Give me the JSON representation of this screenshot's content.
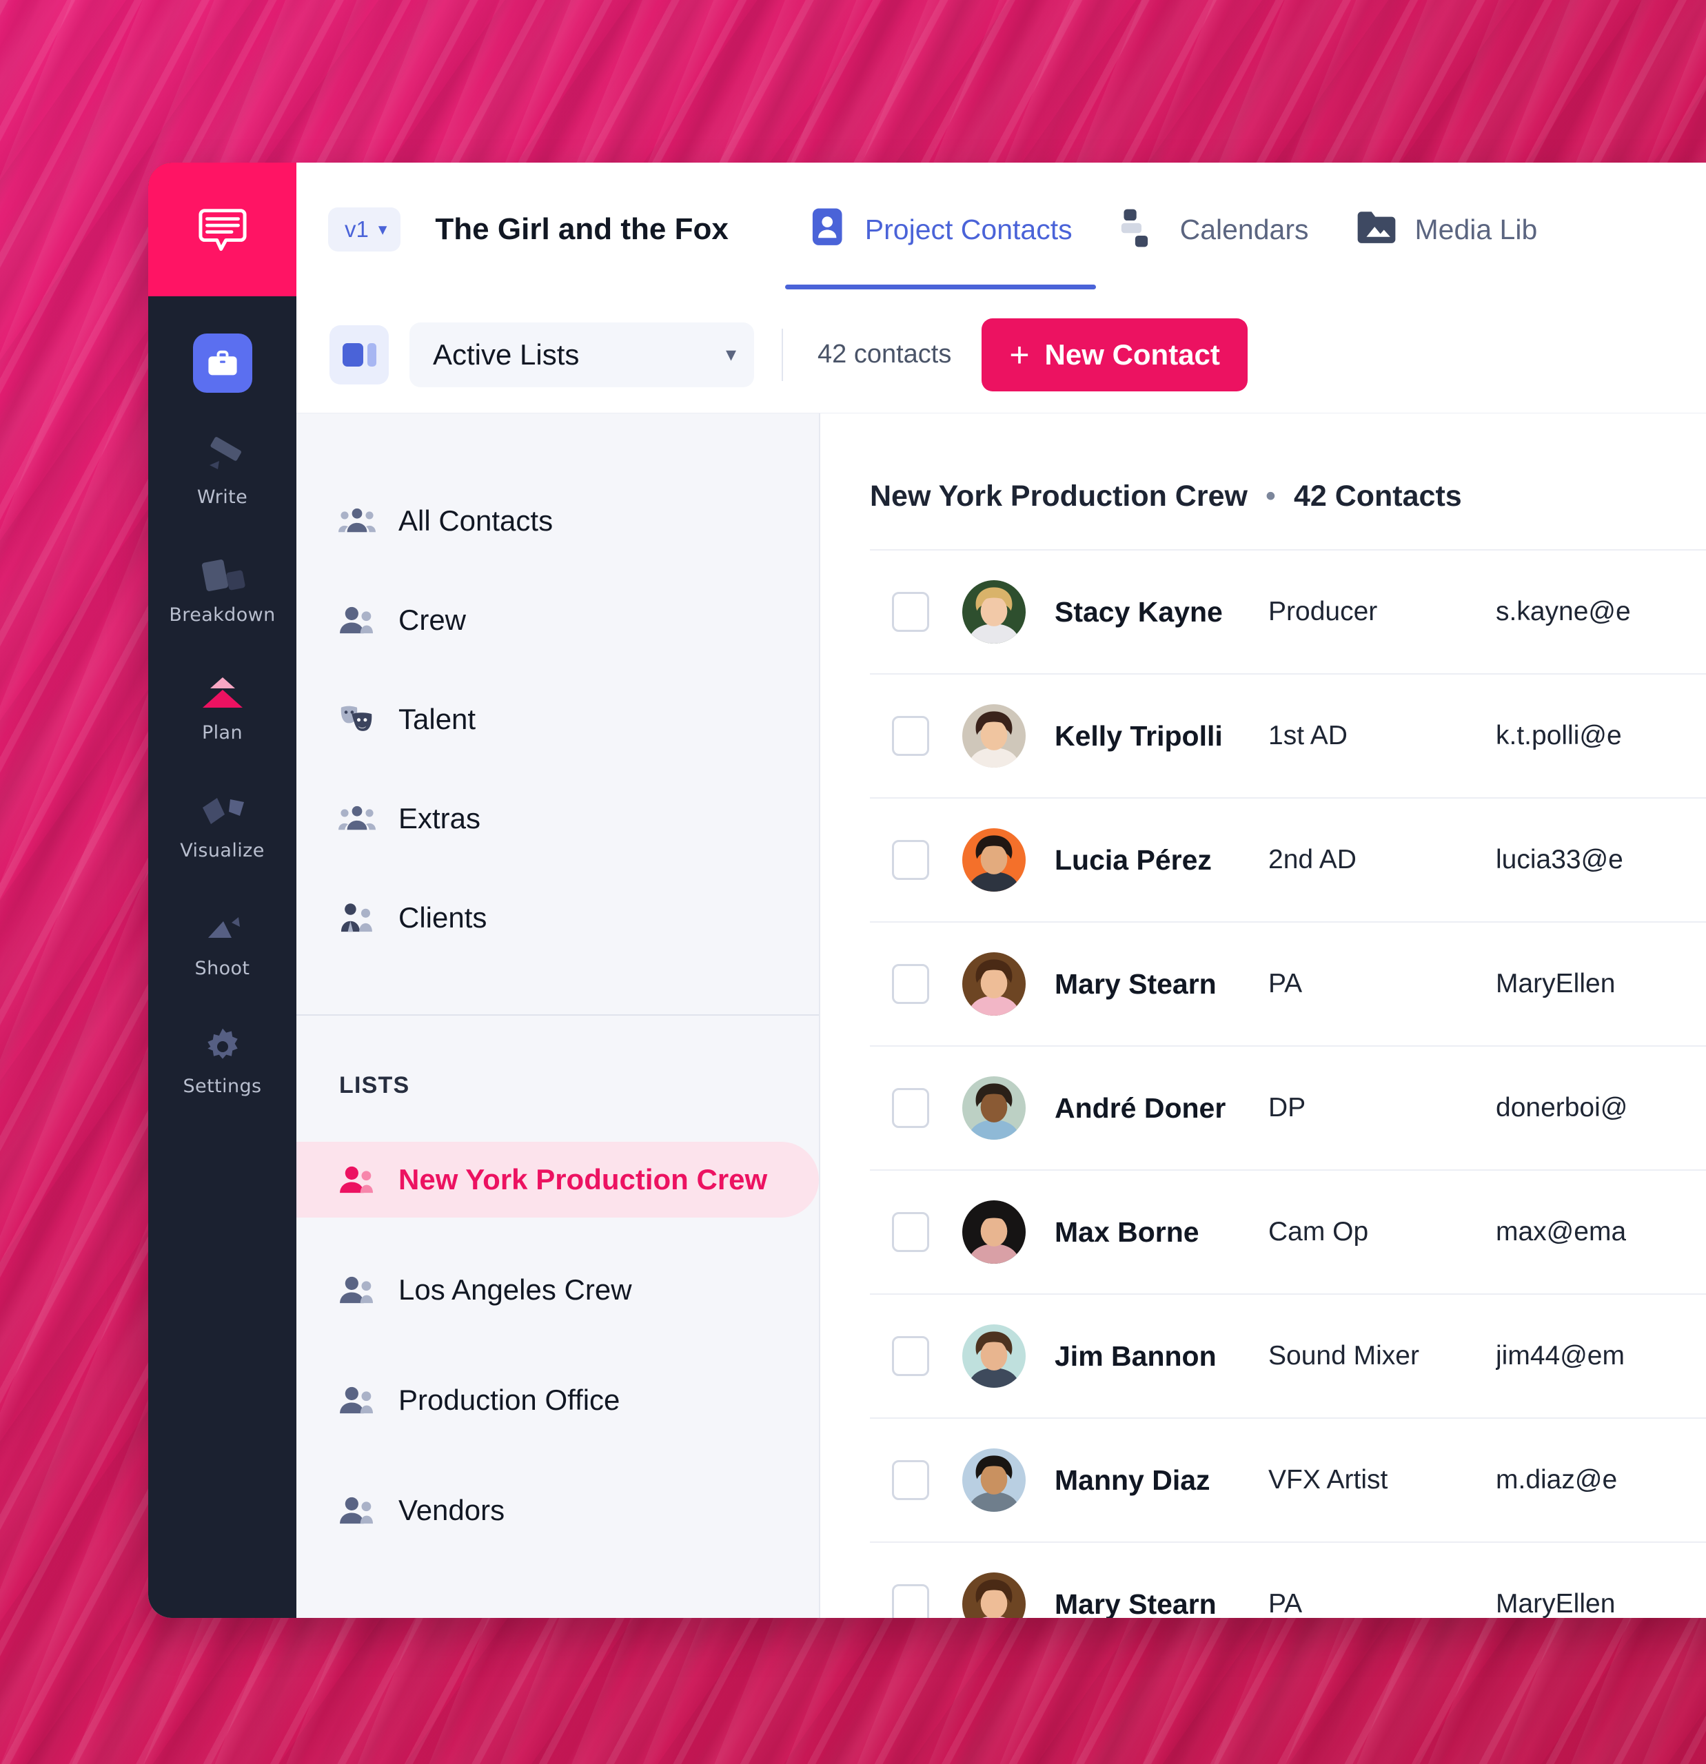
{
  "colors": {
    "brand_pink": "#ec1261",
    "logo_pink": "#ff1464",
    "accent_blue": "#4a63d8",
    "rail_dark": "#1b2130",
    "panel_bg": "#f5f6fa",
    "active_list_bg": "#fce3ec",
    "backdrop_pink": "#d81b60"
  },
  "rail": {
    "logo_icon": "speech-bubble-logo",
    "projects_button": {
      "icon": "briefcase-icon"
    },
    "items": [
      {
        "label": "Write",
        "icon": "pen-icon"
      },
      {
        "label": "Breakdown",
        "icon": "cards-icon"
      },
      {
        "label": "Plan",
        "icon": "triangles-icon",
        "active": true
      },
      {
        "label": "Visualize",
        "icon": "shapes-icon"
      },
      {
        "label": "Shoot",
        "icon": "arrow-shapes-icon"
      },
      {
        "label": "Settings",
        "icon": "gear-icon"
      }
    ]
  },
  "header": {
    "version_chip": {
      "label": "v1",
      "caret": "chevron-down-icon"
    },
    "project_title": "The Girl and the Fox",
    "tabs": [
      {
        "label": "Project Contacts",
        "icon": "contact-card-icon",
        "active": true
      },
      {
        "label": "Calendars",
        "icon": "calendar-blocks-icon",
        "active": false
      },
      {
        "label": "Media Lib",
        "icon": "media-folder-icon",
        "active": false
      }
    ]
  },
  "toolbar": {
    "view_toggle_icon": "split-view-icon",
    "list_select": {
      "value": "Active Lists",
      "caret": "chevron-down-icon"
    },
    "contacts_count": "42 contacts",
    "new_contact": {
      "label": "New Contact",
      "icon": "plus-icon"
    }
  },
  "lists_panel": {
    "categories": [
      {
        "label": "All Contacts",
        "icon": "group-icon"
      },
      {
        "label": "Crew",
        "icon": "two-people-icon"
      },
      {
        "label": "Talent",
        "icon": "theater-masks-icon"
      },
      {
        "label": "Extras",
        "icon": "group-icon"
      },
      {
        "label": "Clients",
        "icon": "business-people-icon"
      }
    ],
    "lists_heading": "LISTS",
    "lists": [
      {
        "label": "New York Production Crew",
        "icon": "two-people-icon",
        "active": true
      },
      {
        "label": "Los Angeles Crew",
        "icon": "two-people-icon",
        "active": false
      },
      {
        "label": "Production Office",
        "icon": "two-people-icon",
        "active": false
      },
      {
        "label": "Vendors",
        "icon": "two-people-icon",
        "active": false
      }
    ]
  },
  "contacts_panel": {
    "heading_title": "New York Production Crew",
    "heading_separator": "•",
    "heading_count": "42 Contacts",
    "rows": [
      {
        "name": "Stacy Kayne",
        "role": "Producer",
        "email": "s.kayne@e",
        "skin": "#f2c9a8",
        "hair": "#d9b36a",
        "bg": "#2e4f2e",
        "shirt": "#e8e8ec"
      },
      {
        "name": "Kelly Tripolli",
        "role": "1st AD",
        "email": "k.t.polli@e",
        "skin": "#f0c5a0",
        "hair": "#3a231b",
        "bg": "#cfc7ba",
        "shirt": "#f3ece6"
      },
      {
        "name": "Lucia Pérez",
        "role": "2nd AD",
        "email": "lucia33@e",
        "skin": "#e3ab7e",
        "hair": "#211713",
        "bg": "#f4702a",
        "shirt": "#2d3440"
      },
      {
        "name": "Mary Stearn",
        "role": "PA",
        "email": "MaryEllen",
        "skin": "#eebd97",
        "hair": "#4a2a15",
        "bg": "#6d4523",
        "shirt": "#f2b6c6"
      },
      {
        "name": "André Doner",
        "role": "DP",
        "email": "donerboi@",
        "skin": "#8a5a34",
        "hair": "#2a2018",
        "bg": "#bcd0c4",
        "shirt": "#8fb9d6"
      },
      {
        "name": "Max Borne",
        "role": "Cam Op",
        "email": "max@ema",
        "skin": "#e8b590",
        "hair": "#161414",
        "bg": "#161414",
        "shirt": "#d9a0a6"
      },
      {
        "name": "Jim Bannon",
        "role": "Sound Mixer",
        "email": "jim44@em",
        "skin": "#e8b58f",
        "hair": "#4d3320",
        "bg": "#bfe0dd",
        "shirt": "#3e4a5c"
      },
      {
        "name": "Manny Diaz",
        "role": "VFX Artist",
        "email": "m.diaz@e",
        "skin": "#c99160",
        "hair": "#191512",
        "bg": "#b9cfe2",
        "shirt": "#6f7e8c"
      },
      {
        "name": "Mary Stearn",
        "role": "PA",
        "email": "MaryEllen",
        "skin": "#eebd97",
        "hair": "#4a2a15",
        "bg": "#6d4523",
        "shirt": "#f2b6c6"
      }
    ]
  }
}
